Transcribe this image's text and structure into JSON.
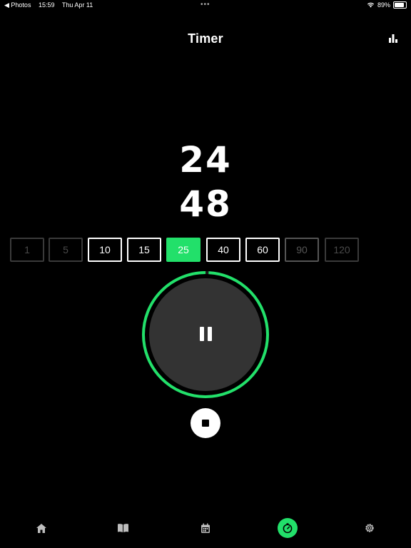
{
  "status_bar": {
    "back_app": "◀ Photos",
    "time": "15:59",
    "date": "Thu Apr 11",
    "more_dots": "•••",
    "battery_percent": "89%",
    "battery_level": 0.89
  },
  "header": {
    "title": "Timer"
  },
  "timer": {
    "minutes": "24",
    "seconds": "48"
  },
  "presets": [
    {
      "label": "1",
      "state": "faded"
    },
    {
      "label": "5",
      "state": "faded"
    },
    {
      "label": "10",
      "state": "normal"
    },
    {
      "label": "15",
      "state": "normal"
    },
    {
      "label": "25",
      "state": "active"
    },
    {
      "label": "40",
      "state": "normal"
    },
    {
      "label": "60",
      "state": "normal"
    },
    {
      "label": "90",
      "state": "semi"
    },
    {
      "label": "120",
      "state": "faded"
    }
  ],
  "progress": {
    "remaining_fraction": 0.992
  },
  "colors": {
    "accent": "#22e06a",
    "dial_fill": "#333333",
    "background": "#000000"
  },
  "tabbar": {
    "tabs": [
      {
        "icon": "home-icon",
        "active": false
      },
      {
        "icon": "book-icon",
        "active": false
      },
      {
        "icon": "calendar-icon",
        "active": false
      },
      {
        "icon": "timer-icon",
        "active": true
      },
      {
        "icon": "gear-icon",
        "active": false
      }
    ]
  }
}
